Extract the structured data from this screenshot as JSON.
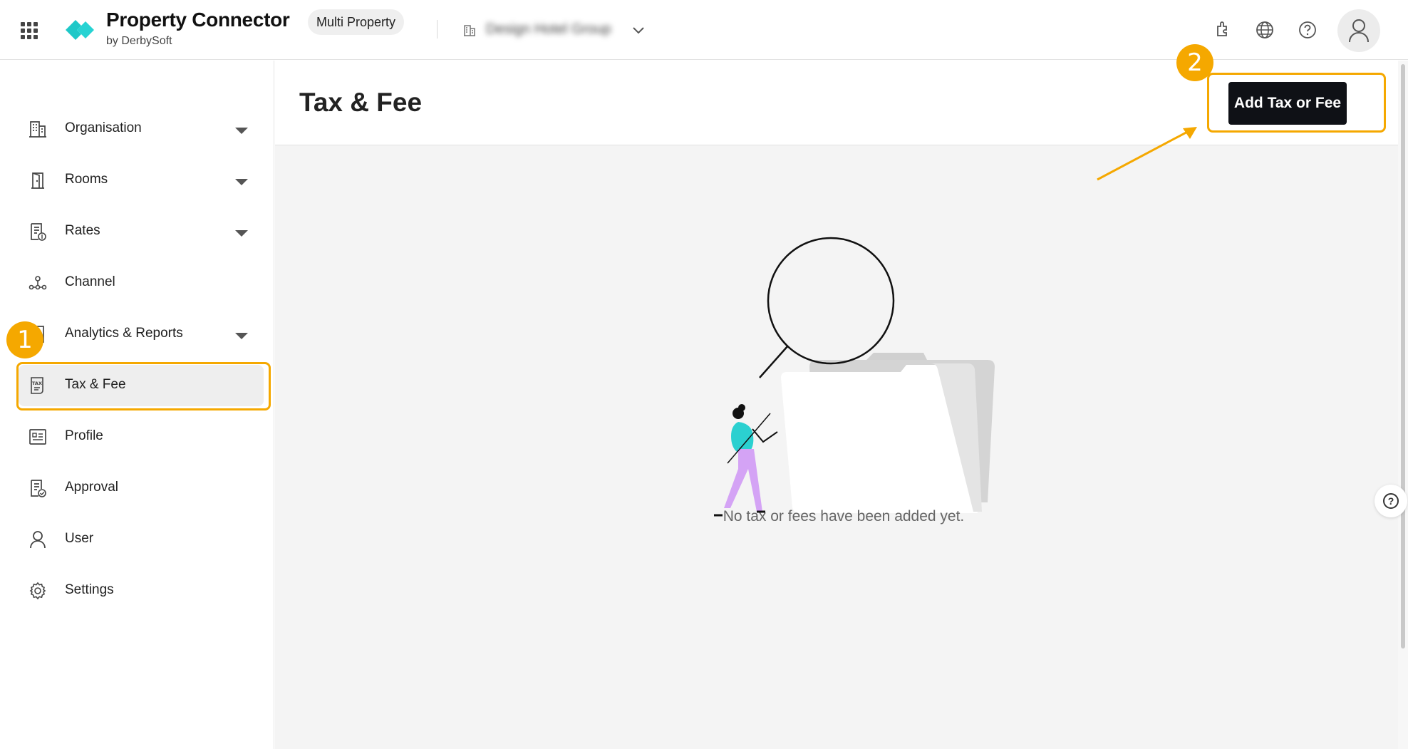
{
  "app": {
    "name": "Property Connector",
    "subtitle": "by DerbySoft",
    "mode_badge": "Multi Property",
    "org_name": "Design Hotel Group",
    "brand_color": "#1ec8c8"
  },
  "header": {
    "icons": [
      "apps-grid-icon",
      "plugin-icon",
      "globe-icon",
      "help-icon",
      "user-avatar-icon"
    ]
  },
  "sidebar": {
    "items": [
      {
        "label": "Organisation",
        "icon": "building-icon",
        "expandable": true
      },
      {
        "label": "Rooms",
        "icon": "door-icon",
        "expandable": true
      },
      {
        "label": "Rates",
        "icon": "rate-document-icon",
        "expandable": true
      },
      {
        "label": "Channel",
        "icon": "channel-network-icon",
        "expandable": false
      },
      {
        "label": "Analytics & Reports",
        "icon": "report-icon",
        "expandable": true
      },
      {
        "label": "Tax & Fee",
        "icon": "tax-document-icon",
        "expandable": false,
        "active": true
      },
      {
        "label": "Profile",
        "icon": "profile-card-icon",
        "expandable": false
      },
      {
        "label": "Approval",
        "icon": "approval-document-icon",
        "expandable": false
      },
      {
        "label": "User",
        "icon": "user-icon",
        "expandable": false
      },
      {
        "label": "Settings",
        "icon": "gear-icon",
        "expandable": false
      }
    ]
  },
  "main": {
    "title": "Tax & Fee",
    "add_button_label": "Add Tax or Fee",
    "empty_message": "No tax or fees have been added yet."
  },
  "annotations": {
    "step1": "1",
    "step2": "2",
    "color": "#f5a800"
  }
}
